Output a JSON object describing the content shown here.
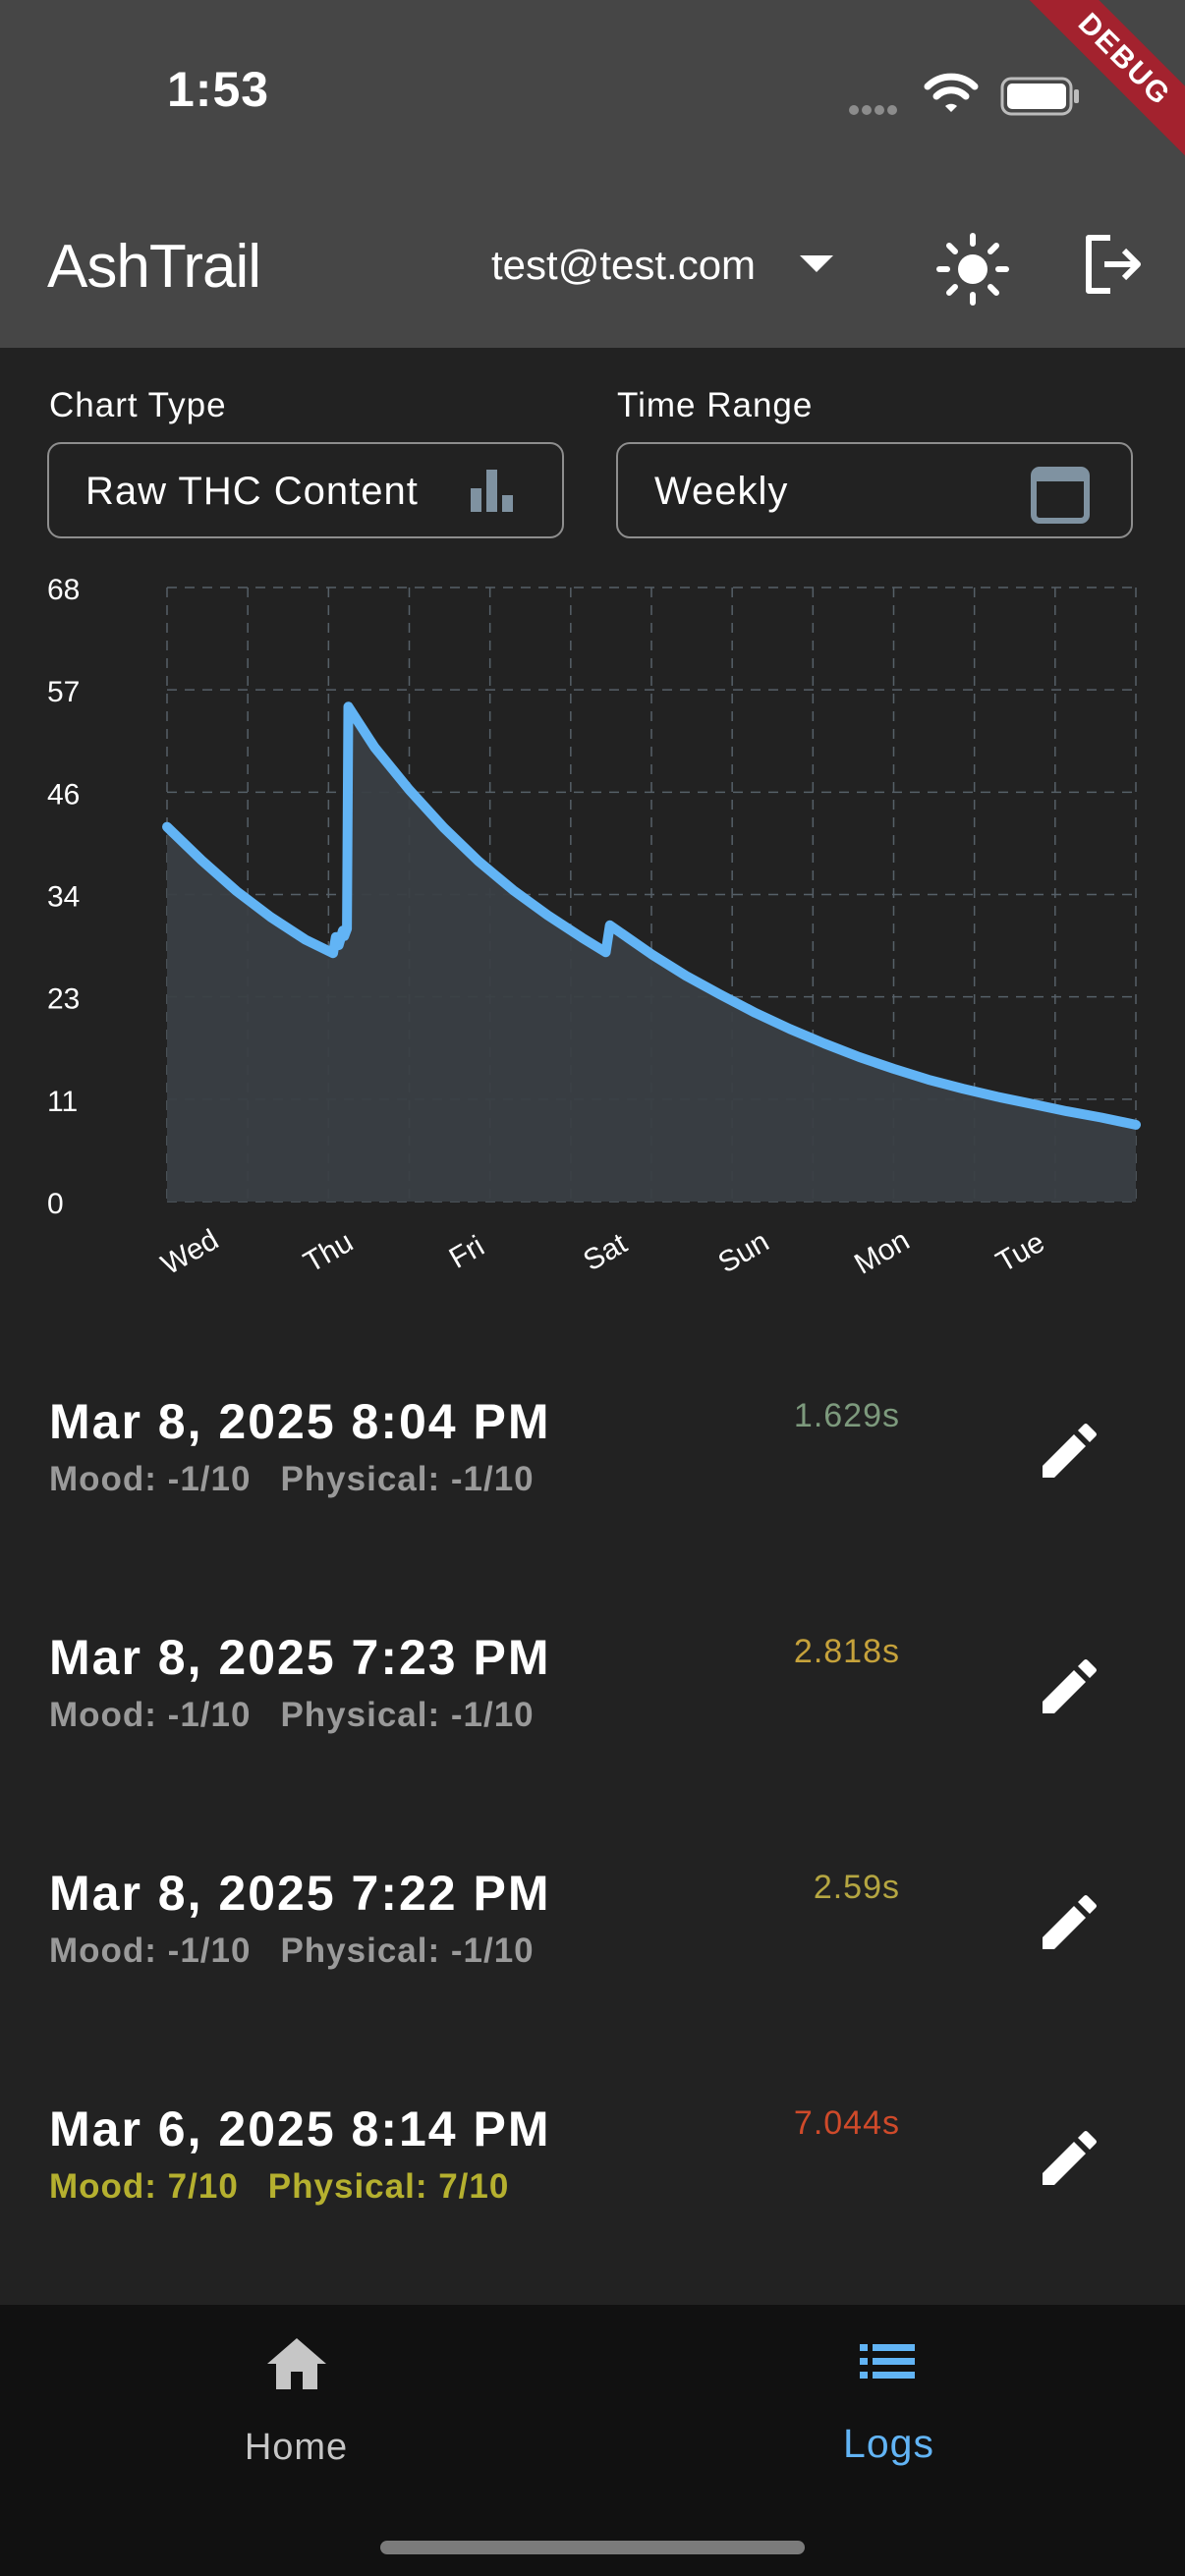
{
  "status_bar": {
    "time": "1:53",
    "debug_banner": "DEBUG"
  },
  "app_bar": {
    "title": "AshTrail",
    "account": "test@test.com"
  },
  "filters": {
    "chart_type": {
      "label": "Chart Type",
      "value": "Raw THC Content"
    },
    "time_range": {
      "label": "Time Range",
      "value": "Weekly"
    }
  },
  "chart_data": {
    "type": "area",
    "title": "",
    "xlabel": "",
    "ylabel": "",
    "x_ticks": [
      "Wed",
      "Thu",
      "Fri",
      "Sat",
      "Sun",
      "Mon",
      "Tue"
    ],
    "y_ticks": [
      "68",
      "57",
      "46",
      "34",
      "23",
      "11",
      "0"
    ],
    "xlim": [
      0,
      7
    ],
    "ylim": [
      0,
      68
    ],
    "grid": true,
    "line_color": "#62b4f5",
    "fill_color": "#3a3f44",
    "series": [
      {
        "points": [
          [
            0.0,
            41.5
          ],
          [
            0.25,
            37.8
          ],
          [
            0.5,
            34.4
          ],
          [
            0.75,
            31.5
          ],
          [
            1.0,
            29.0
          ],
          [
            1.2,
            27.5
          ],
          [
            1.22,
            29.3
          ],
          [
            1.24,
            28.4
          ],
          [
            1.27,
            30.0
          ],
          [
            1.28,
            29.4
          ],
          [
            1.3,
            30.2
          ],
          [
            1.31,
            54.8
          ],
          [
            1.5,
            50.3
          ],
          [
            1.75,
            45.6
          ],
          [
            2.0,
            41.4
          ],
          [
            2.25,
            37.7
          ],
          [
            2.5,
            34.5
          ],
          [
            2.75,
            31.7
          ],
          [
            3.0,
            29.2
          ],
          [
            3.17,
            27.6
          ],
          [
            3.2,
            30.6
          ],
          [
            3.5,
            27.4
          ],
          [
            3.75,
            25.0
          ],
          [
            4.0,
            22.9
          ],
          [
            4.25,
            20.9
          ],
          [
            4.5,
            19.1
          ],
          [
            4.75,
            17.5
          ],
          [
            5.0,
            16.0
          ],
          [
            5.25,
            14.7
          ],
          [
            5.5,
            13.5
          ],
          [
            5.75,
            12.5
          ],
          [
            6.0,
            11.6
          ],
          [
            6.25,
            10.8
          ],
          [
            6.5,
            10.0
          ],
          [
            6.75,
            9.3
          ],
          [
            7.0,
            8.5
          ]
        ]
      }
    ]
  },
  "logs": [
    {
      "date": "Mar 8, 2025 8:04 PM",
      "mood": "Mood: -1/10",
      "physical": "Physical: -1/10",
      "duration": "1.629s",
      "duration_color": "#7d9a7d",
      "meta_color": "#9a9a9a"
    },
    {
      "date": "Mar 8, 2025 7:23 PM",
      "mood": "Mood: -1/10",
      "physical": "Physical: -1/10",
      "duration": "2.818s",
      "duration_color": "#c6a23b",
      "meta_color": "#9a9a9a"
    },
    {
      "date": "Mar 8, 2025 7:22 PM",
      "mood": "Mood: -1/10",
      "physical": "Physical: -1/10",
      "duration": "2.59s",
      "duration_color": "#b5a641",
      "meta_color": "#9a9a9a"
    },
    {
      "date": "Mar 6, 2025 8:14 PM",
      "mood": "Mood: 7/10",
      "physical": "Physical: 7/10",
      "duration": "7.044s",
      "duration_color": "#cf4a2a",
      "meta_color": "#b5b02f"
    }
  ],
  "bottom_nav": {
    "home": {
      "label": "Home",
      "icon": "home-icon",
      "color": "#c6c6c6"
    },
    "logs": {
      "label": "Logs",
      "icon": "list-icon",
      "color": "#62b4f5",
      "active": true
    }
  }
}
